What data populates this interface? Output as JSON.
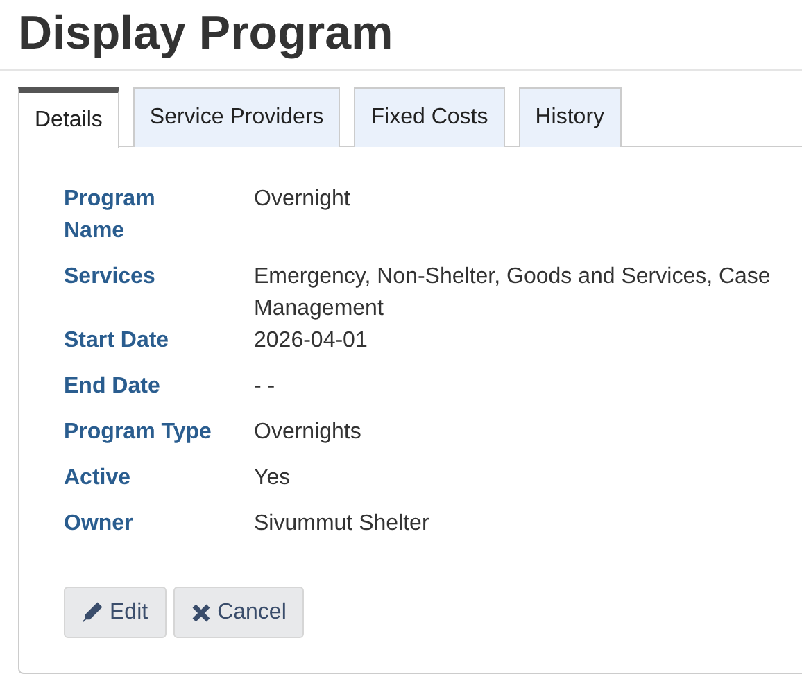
{
  "page": {
    "title": "Display Program"
  },
  "tabs": [
    {
      "label": "Details",
      "selected": true
    },
    {
      "label": "Service Providers",
      "selected": false
    },
    {
      "label": "Fixed Costs",
      "selected": false
    },
    {
      "label": "History",
      "selected": false
    }
  ],
  "fields": [
    {
      "label": "Program Name",
      "value": "Overnight"
    },
    {
      "label": "Services",
      "value": "Emergency, Non-Shelter, Goods and Services, Case Management"
    },
    {
      "label": "Start Date",
      "value": "2026-04-01"
    },
    {
      "label": "End Date",
      "value": "- -"
    },
    {
      "label": "Program Type",
      "value": "Overnights"
    },
    {
      "label": "Active",
      "value": "Yes"
    },
    {
      "label": "Owner",
      "value": "Sivummut Shelter"
    }
  ],
  "buttons": [
    {
      "kind": "edit",
      "label": "Edit"
    },
    {
      "kind": "cancel",
      "label": "Cancel"
    }
  ]
}
